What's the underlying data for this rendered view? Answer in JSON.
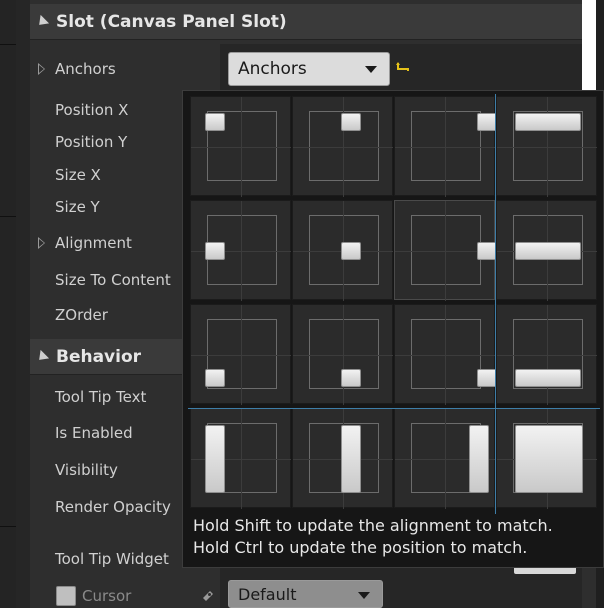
{
  "sections": {
    "slot": {
      "title": "Slot (Canvas Panel Slot)"
    },
    "behavior": {
      "title": "Behavior"
    }
  },
  "slot_properties": [
    {
      "label": "Anchors",
      "expandable": true
    },
    {
      "label": "Position X"
    },
    {
      "label": "Position Y"
    },
    {
      "label": "Size X"
    },
    {
      "label": "Size Y"
    },
    {
      "label": "Alignment",
      "expandable": true
    },
    {
      "label": "Size To Content"
    },
    {
      "label": "ZOrder"
    }
  ],
  "behavior_properties": [
    {
      "label": "Tool Tip Text"
    },
    {
      "label": "Is Enabled"
    },
    {
      "label": "Visibility"
    },
    {
      "label": "Render Opacity"
    },
    {
      "label": "Tool Tip Widget"
    },
    {
      "label": "Cursor"
    }
  ],
  "anchors_combo": {
    "value": "Anchors"
  },
  "cursor_combo": {
    "value": "Default"
  },
  "anchor_presets": [
    [
      "top-left",
      "top-center",
      "top-right",
      "top-stretch"
    ],
    [
      "center-left",
      "center",
      "center-right",
      "center-stretch"
    ],
    [
      "bottom-left",
      "bottom-center",
      "bottom-right",
      "bottom-stretch"
    ],
    [
      "left-stretch",
      "center-stretch-vertical",
      "right-stretch",
      "full-stretch"
    ]
  ],
  "popup_hint": {
    "line1": "Hold Shift to update the alignment to match.",
    "line2": "Hold Ctrl to update the position to match."
  },
  "colors": {
    "panel_bg": "#2e2e2e",
    "popup_bg": "#161616",
    "separator": "#3e7ea8",
    "reset_arrow": "#e5c21a"
  },
  "icons": {
    "section_arrow": "collapse-arrow-icon",
    "expander": "expand-arrow-icon",
    "combo_caret": "chevron-down-icon",
    "reset": "reset-to-default-icon",
    "cursor_pin": "pin-icon"
  }
}
